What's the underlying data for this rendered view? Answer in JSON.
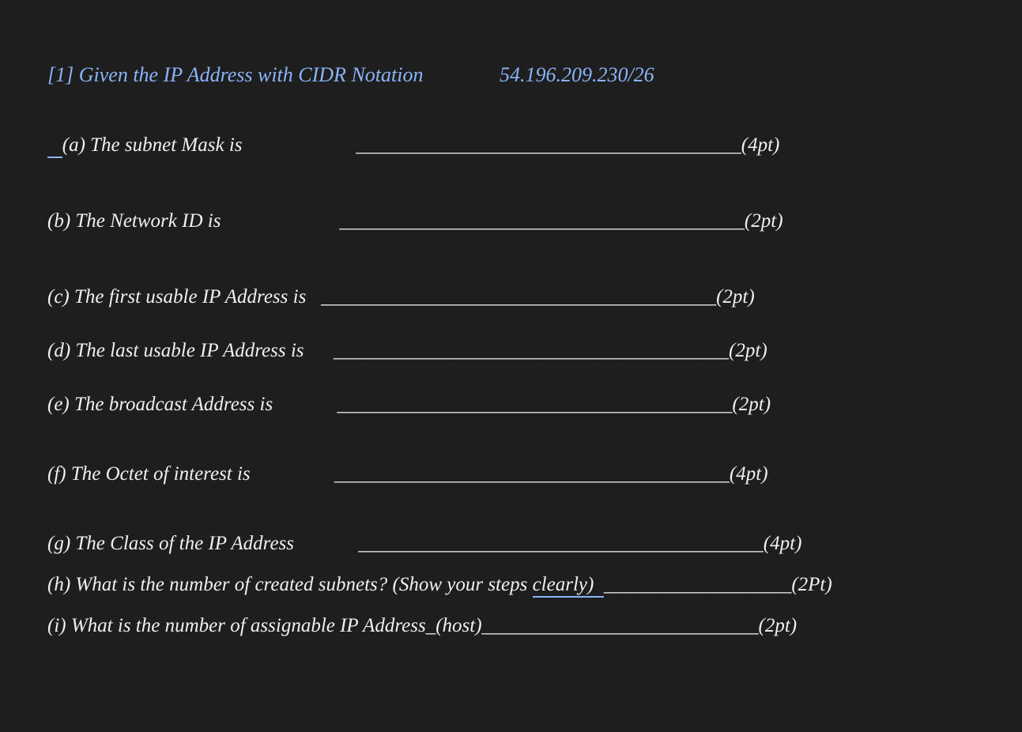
{
  "title": {
    "prefix": "[1] Given the IP Address with CIDR Notation",
    "ip": "54.196.209.230/26"
  },
  "questions": {
    "a": {
      "lead": "   ",
      "label": "(a) The subnet Mask is",
      "gap": "                       ",
      "blank": "_______________________________________",
      "points": "(4pt)"
    },
    "b": {
      "label": " (b)  The Network ID is",
      "gap": "                        ",
      "blank": "_________________________________________",
      "points": "(2pt)"
    },
    "c": {
      "label": " (c)  The first usable IP Address is",
      "gap": "   ",
      "blank": "________________________________________",
      "points": "(2pt)"
    },
    "d": {
      "label": " (d) The last usable IP Address is",
      "gap": "      ",
      "blank": "________________________________________",
      "points": "(2pt)"
    },
    "e": {
      "label": " (e) The broadcast Address is",
      "gap": "             ",
      "blank": "________________________________________",
      "points": "(2pt)"
    },
    "f": {
      "label": " (f) The Octet of interest is",
      "gap": "                 ",
      "blank": "________________________________________ ",
      "points": "(4pt)"
    },
    "g": {
      "label": "(g) The Class of the IP Address",
      "gap": "             ",
      "blank": "_________________________________________",
      "points": "(4pt)"
    },
    "h": {
      "label_prefix": "(h) What is the number of created subnets? (Show your steps ",
      "label_underlined": "clearly)",
      "gap": "",
      "blank": "___________________ ",
      "points": "(2Pt)"
    },
    "i": {
      "label_prefix": "(i) What is the number of assignable IP Address",
      "label_mid": "_(host) ",
      "blank": "____________________________",
      "points": "(2pt)"
    }
  }
}
